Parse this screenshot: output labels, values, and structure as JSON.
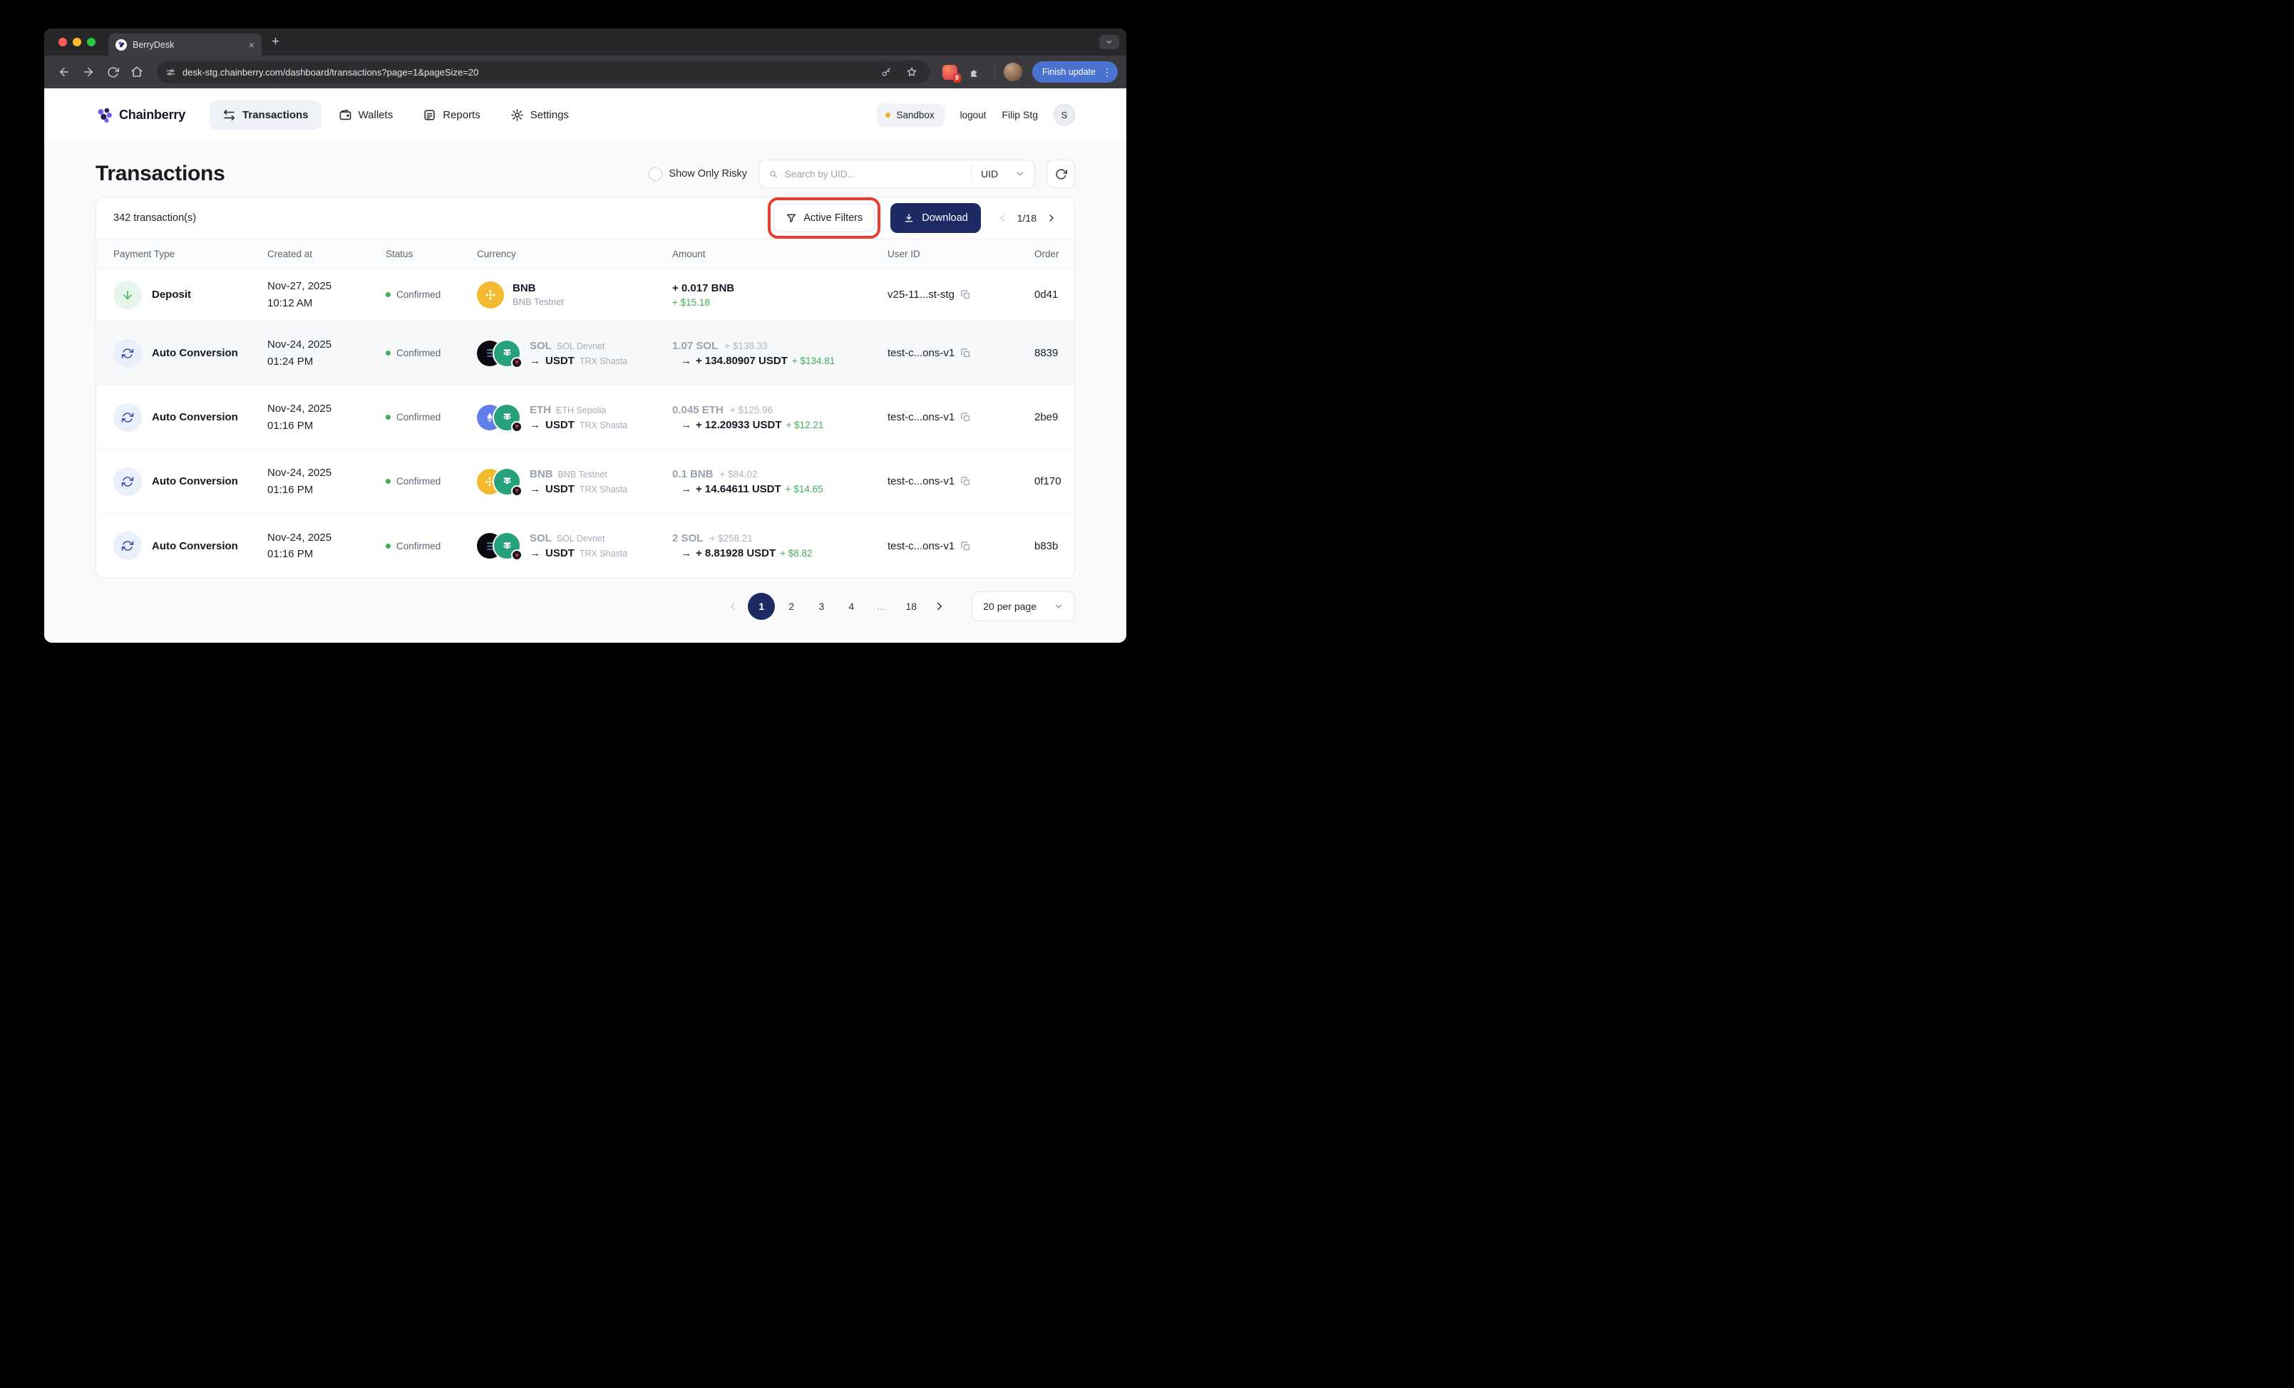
{
  "browser": {
    "tab_title": "BerryDesk",
    "url": "desk-stg.chainberry.com/dashboard/transactions?page=1&pageSize=20",
    "update_button": "Finish update",
    "extension_badge": "9"
  },
  "header": {
    "brand": "Chainberry",
    "nav": [
      {
        "label": "Transactions"
      },
      {
        "label": "Wallets"
      },
      {
        "label": "Reports"
      },
      {
        "label": "Settings"
      }
    ],
    "env_badge": "Sandbox",
    "logout_label": "logout",
    "user_name": "Filip Stg",
    "avatar_initial": "S"
  },
  "controls": {
    "title": "Transactions",
    "risky_label": "Show Only Risky",
    "search_placeholder": "Search by UID...",
    "search_type": "UID"
  },
  "card": {
    "count": "342 transaction(s)",
    "active_filters_label": "Active Filters",
    "download_label": "Download",
    "page_indicator": "1/18"
  },
  "table": {
    "headers": [
      "Payment Type",
      "Created at",
      "Status",
      "Currency",
      "Amount",
      "User ID",
      "Order"
    ],
    "rows": [
      {
        "payment_type": "Deposit",
        "date": "Nov-27, 2025",
        "time": "10:12 AM",
        "status": "Confirmed",
        "coin": "BNB",
        "network": "BNB Testnet",
        "amount": "+ 0.017 BNB",
        "amount_usd": "+ $15.18",
        "user_id": "v25-11...st-stg",
        "order_id": "0d41"
      },
      {
        "payment_type": "Auto Conversion",
        "date": "Nov-24, 2025",
        "time": "01:24 PM",
        "status": "Confirmed",
        "from_coin": "SOL",
        "from_network": "SOL Devnet",
        "to_coin": "USDT",
        "to_network": "TRX Shasta",
        "from_amount": "1.07 SOL",
        "from_usd": "+ $138.33",
        "to_amount": "+ 134.80907 USDT",
        "to_usd": "+ $134.81",
        "user_id": "test-c...ons-v1",
        "order_id": "8839"
      },
      {
        "payment_type": "Auto Conversion",
        "date": "Nov-24, 2025",
        "time": "01:16 PM",
        "status": "Confirmed",
        "from_coin": "ETH",
        "from_network": "ETH Sepolia",
        "to_coin": "USDT",
        "to_network": "TRX Shasta",
        "from_amount": "0.045 ETH",
        "from_usd": "+ $125.96",
        "to_amount": "+ 12.20933 USDT",
        "to_usd": "+ $12.21",
        "user_id": "test-c...ons-v1",
        "order_id": "2be9"
      },
      {
        "payment_type": "Auto Conversion",
        "date": "Nov-24, 2025",
        "time": "01:16 PM",
        "status": "Confirmed",
        "from_coin": "BNB",
        "from_network": "BNB Testnet",
        "to_coin": "USDT",
        "to_network": "TRX Shasta",
        "from_amount": "0.1 BNB",
        "from_usd": "+ $84.02",
        "to_amount": "+ 14.64611 USDT",
        "to_usd": "+ $14.65",
        "user_id": "test-c...ons-v1",
        "order_id": "0f170"
      },
      {
        "payment_type": "Auto Conversion",
        "date": "Nov-24, 2025",
        "time": "01:16 PM",
        "status": "Confirmed",
        "from_coin": "SOL",
        "from_network": "SOL Devnet",
        "to_coin": "USDT",
        "to_network": "TRX Shasta",
        "from_amount": "2 SOL",
        "from_usd": "+ $258.21",
        "to_amount": "+ 8.81928 USDT",
        "to_usd": "+ $8.82",
        "user_id": "test-c...ons-v1",
        "order_id": "b83b"
      }
    ]
  },
  "pagination": {
    "pages": [
      "1",
      "2",
      "3",
      "4",
      "...",
      "18"
    ],
    "active_page": "1",
    "per_page": "20 per page"
  },
  "ui": {
    "arrow": "→",
    "tab_close": "×",
    "new_tab": "+",
    "menu_dots": "⋮"
  },
  "colors": {
    "accent_navy": "#1e2a63",
    "positive_green": "#3fae5a",
    "annotation_red": "#ee3b2b",
    "bnb_gold": "#f3ba2f",
    "eth_purple": "#627eea",
    "usdt_teal": "#26a17b"
  }
}
